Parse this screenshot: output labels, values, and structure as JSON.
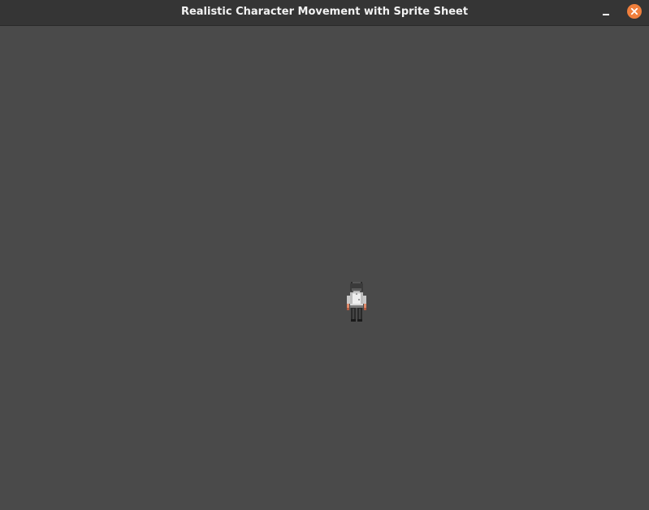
{
  "window": {
    "title": "Realistic Character Movement with Sprite Sheet"
  },
  "controls": {
    "minimize_icon": "minimize-icon",
    "close_icon": "close-icon",
    "close_color": "#f07f3c"
  },
  "game": {
    "background_color": "#4a4a4a",
    "character": {
      "facing": "down",
      "hair_color": "#2e2e2e",
      "shirt_color": "#d9d9d9",
      "pants_color": "#2a2a2a",
      "skin_color": "#e08a6a"
    }
  }
}
